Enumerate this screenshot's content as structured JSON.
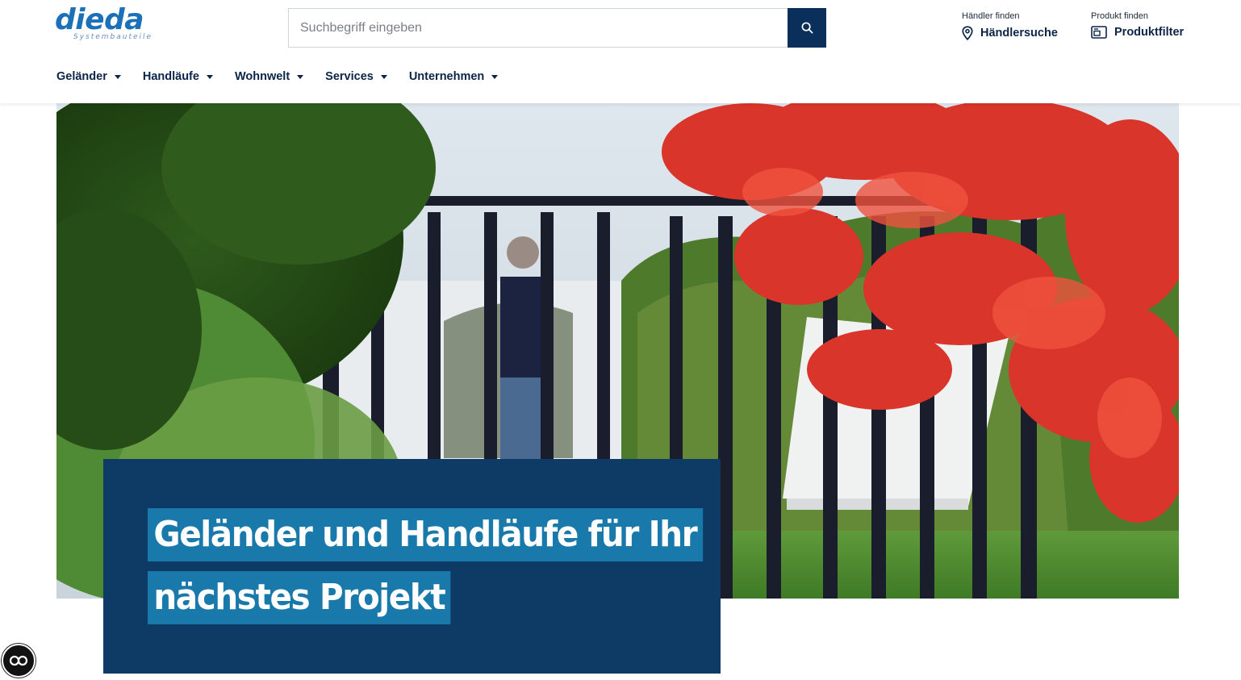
{
  "brand": {
    "name": "dieda",
    "tagline": "Systembauteile",
    "color": "#1b70b8"
  },
  "search": {
    "placeholder": "Suchbegriff eingeben",
    "icon": "search-icon"
  },
  "utility": {
    "dealer": {
      "small": "Händler finden",
      "label": "Händlersuche",
      "icon": "map-pin-icon"
    },
    "product": {
      "small": "Produkt finden",
      "label": "Produktfilter",
      "icon": "filter-icon"
    }
  },
  "nav": [
    {
      "label": "Geländer"
    },
    {
      "label": "Handläufe"
    },
    {
      "label": "Wohnwelt"
    },
    {
      "label": "Services"
    },
    {
      "label": "Unternehmen"
    }
  ],
  "hero": {
    "headline_line1": "Geländer und Handläufe für Ihr",
    "headline_line2": "nächstes Projekt",
    "box_color": "#0d3b66",
    "highlight_color": "#1979ab"
  },
  "accessibility": {
    "icon": "accessibility-icon"
  }
}
